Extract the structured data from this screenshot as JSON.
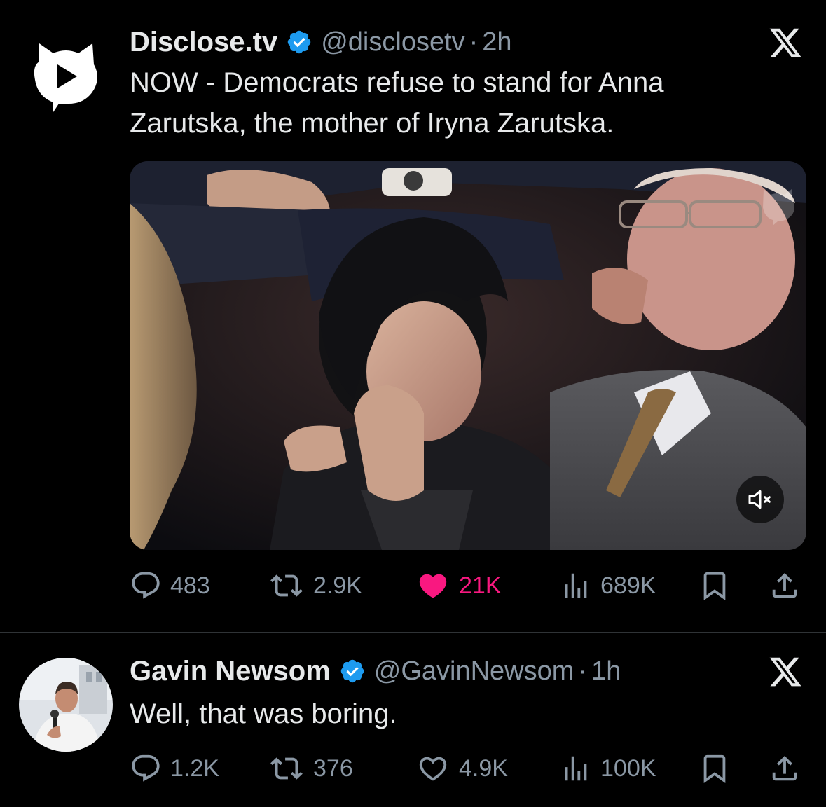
{
  "tweet1": {
    "display_name": "Disclose.tv",
    "handle": "@disclosetv",
    "separator": "·",
    "time": "2h",
    "text_line1": "NOW - Democrats refuse to stand for Anna",
    "text_line2": "Zarutska, the mother of Iryna Zarutska.",
    "avatar_icon": "disclosetv-logo-icon",
    "media": {
      "type": "video",
      "muted": true
    },
    "stats": {
      "replies": "483",
      "reposts": "2.9K",
      "likes": "21K",
      "views": "689K"
    },
    "liked": true
  },
  "tweet2": {
    "display_name": "Gavin Newsom",
    "handle": "@GavinNewsom",
    "separator": "·",
    "time": "1h",
    "text": "Well, that was boring.",
    "stats": {
      "replies": "1.2K",
      "reposts": "376",
      "likes": "4.9K",
      "views": "100K"
    },
    "liked": false
  },
  "colors": {
    "background": "#000000",
    "text": "#e7e9ea",
    "muted": "#8b98a5",
    "verified": "#1d9bf0",
    "like": "#f91880"
  }
}
